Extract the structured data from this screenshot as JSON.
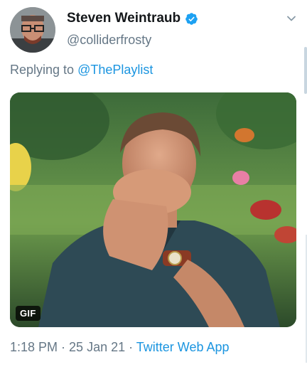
{
  "tweet": {
    "author": {
      "display_name": "Steven Weintraub",
      "handle": "@colliderfrosty",
      "verified": true
    },
    "reply": {
      "prefix": "Replying to ",
      "mention": "@ThePlaylist"
    },
    "media": {
      "badge": "GIF"
    },
    "meta": {
      "time": "1:18 PM",
      "separator_1": " · ",
      "date": "25 Jan 21",
      "separator_2": " · ",
      "source": "Twitter Web App"
    }
  },
  "colors": {
    "text_primary": "#14171a",
    "text_secondary": "#657786",
    "link": "#1b95e0",
    "verified_badge": "#1da1f2"
  },
  "icons": {
    "verified": "verified-badge-icon",
    "more": "chevron-down-icon"
  }
}
